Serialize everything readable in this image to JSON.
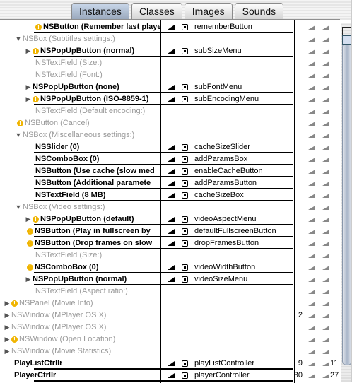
{
  "tabs": [
    {
      "label": "Instances",
      "active": true
    },
    {
      "label": "Classes",
      "active": false
    },
    {
      "label": "Images",
      "active": false
    },
    {
      "label": "Sounds",
      "active": false
    }
  ],
  "rows": [
    {
      "indent": 50,
      "tri": "",
      "warn": true,
      "name": "NSButton (Remember last playe",
      "style": "bold",
      "mark": true,
      "outlet": "rememberButton",
      "line": true
    },
    {
      "indent": 20,
      "tri": "▼",
      "warn": false,
      "name": "NSBox (Subtitles settings:)",
      "style": "dim",
      "mark": false,
      "outlet": "",
      "line": false
    },
    {
      "indent": 34,
      "tri": "▶",
      "warn": true,
      "name": "NSPopUpButton (normal)",
      "style": "bold",
      "mark": true,
      "outlet": "subSizeMenu",
      "line": true
    },
    {
      "indent": 50,
      "tri": "",
      "warn": false,
      "name": "NSTextField (Size:)",
      "style": "dim",
      "mark": false,
      "outlet": "",
      "line": false
    },
    {
      "indent": 50,
      "tri": "",
      "warn": false,
      "name": "NSTextField (Font:)",
      "style": "dim",
      "mark": false,
      "outlet": "",
      "line": false
    },
    {
      "indent": 34,
      "tri": "▶",
      "warn": false,
      "name": "NSPopUpButton (none)",
      "style": "bold",
      "mark": true,
      "outlet": "subFontMenu",
      "line": true
    },
    {
      "indent": 34,
      "tri": "▶",
      "warn": true,
      "name": "NSPopUpButton (ISO-8859-1)",
      "style": "bold",
      "mark": true,
      "outlet": "subEncodingMenu",
      "line": true
    },
    {
      "indent": 50,
      "tri": "",
      "warn": false,
      "name": "NSTextField (Default encoding:)",
      "style": "dim",
      "mark": false,
      "outlet": "",
      "line": false
    },
    {
      "indent": 24,
      "tri": "",
      "warn": true,
      "name": "NSButton (Cancel)",
      "style": "dim",
      "mark": false,
      "outlet": "",
      "line": false
    },
    {
      "indent": 20,
      "tri": "▼",
      "warn": false,
      "name": "NSBox (Miscellaneous settings:)",
      "style": "dim",
      "mark": false,
      "outlet": "",
      "line": false
    },
    {
      "indent": 50,
      "tri": "",
      "warn": false,
      "name": "NSSlider (0)",
      "style": "bold",
      "mark": true,
      "outlet": "cacheSizeSlider",
      "line": true
    },
    {
      "indent": 50,
      "tri": "",
      "warn": false,
      "name": "NSComboBox (0)",
      "style": "bold",
      "mark": true,
      "outlet": "addParamsBox",
      "line": true
    },
    {
      "indent": 50,
      "tri": "",
      "warn": false,
      "name": "NSButton (Use cache (slow med",
      "style": "bold",
      "mark": true,
      "outlet": "enableCacheButton",
      "line": true
    },
    {
      "indent": 50,
      "tri": "",
      "warn": false,
      "name": "NSButton (Additional paramete",
      "style": "bold",
      "mark": true,
      "outlet": "addParamsButton",
      "line": true
    },
    {
      "indent": 50,
      "tri": "",
      "warn": false,
      "name": "NSTextField (8 MB)",
      "style": "bold",
      "mark": true,
      "outlet": "cacheSizeBox",
      "line": true
    },
    {
      "indent": 20,
      "tri": "▼",
      "warn": false,
      "name": "NSBox (Video settings:)",
      "style": "dim",
      "mark": false,
      "outlet": "",
      "line": false
    },
    {
      "indent": 34,
      "tri": "▶",
      "warn": true,
      "name": "NSPopUpButton (default)",
      "style": "bold",
      "mark": true,
      "outlet": "videoAspectMenu",
      "line": true
    },
    {
      "indent": 38,
      "tri": "",
      "warn": true,
      "name": "NSButton (Play in fullscreen by",
      "style": "bold",
      "mark": true,
      "outlet": "defaultFullscreenButton",
      "line": true
    },
    {
      "indent": 38,
      "tri": "",
      "warn": true,
      "name": "NSButton (Drop frames on slow",
      "style": "bold",
      "mark": true,
      "outlet": "dropFramesButton",
      "line": true
    },
    {
      "indent": 50,
      "tri": "",
      "warn": false,
      "name": "NSTextField (Size:)",
      "style": "dim",
      "mark": false,
      "outlet": "",
      "line": false
    },
    {
      "indent": 38,
      "tri": "",
      "warn": true,
      "name": "NSComboBox (0)",
      "style": "bold",
      "mark": true,
      "outlet": "videoWidthButton",
      "line": true
    },
    {
      "indent": 34,
      "tri": "▶",
      "warn": false,
      "name": "NSPopUpButton (normal)",
      "style": "bold",
      "mark": true,
      "outlet": "videoSizeMenu",
      "line": true
    },
    {
      "indent": 50,
      "tri": "",
      "warn": false,
      "name": "NSTextField (Aspect ratio:)",
      "style": "dim",
      "mark": false,
      "outlet": "",
      "line": false
    },
    {
      "indent": 4,
      "tri": "▶",
      "warn": true,
      "name": "NSPanel (Movie Info)",
      "style": "dim",
      "mark": false,
      "outlet": "",
      "line": false
    },
    {
      "indent": 4,
      "tri": "▶",
      "warn": false,
      "name": "NSWindow (MPlayer OS X)",
      "style": "dim",
      "mark": false,
      "outlet": "",
      "line": false,
      "count": "2"
    },
    {
      "indent": 4,
      "tri": "▶",
      "warn": false,
      "name": "NSWindow (MPlayer OS X)",
      "style": "dim",
      "mark": false,
      "outlet": "",
      "line": false
    },
    {
      "indent": 4,
      "tri": "▶",
      "warn": true,
      "name": "NSWindow (Open Location)",
      "style": "dim",
      "mark": false,
      "outlet": "",
      "line": false
    },
    {
      "indent": 4,
      "tri": "▶",
      "warn": false,
      "name": "NSWindow (Movie Statistics)",
      "style": "dim",
      "mark": false,
      "outlet": "",
      "line": false
    },
    {
      "indent": 20,
      "tri": "",
      "warn": false,
      "name": "PlayListCtrllr",
      "style": "bold",
      "mark": true,
      "outlet": "playListController",
      "line": true,
      "count": "9",
      "count2": "11"
    },
    {
      "indent": 20,
      "tri": "",
      "warn": false,
      "name": "PlayerCtrllr",
      "style": "bold",
      "mark": true,
      "outlet": "playerController",
      "line": true,
      "count": "30",
      "count2": "27"
    }
  ]
}
